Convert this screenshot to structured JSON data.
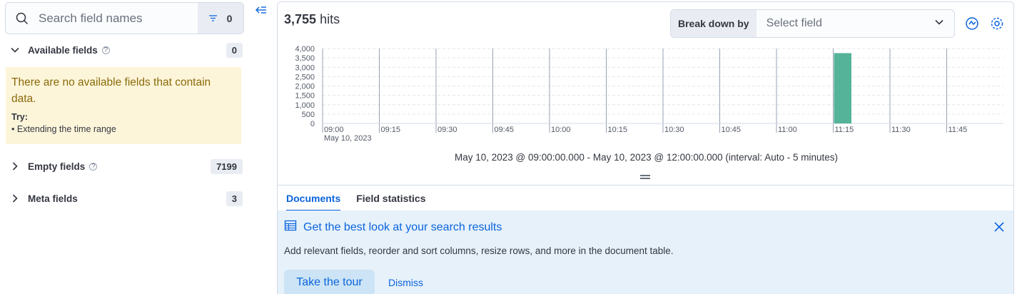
{
  "sidebar": {
    "search_placeholder": "Search field names",
    "filter_count": "0",
    "available": {
      "title": "Available fields",
      "count": "0"
    },
    "callout": {
      "message": "There are no available fields that contain data.",
      "try_label": "Try:",
      "suggestions": [
        "Extending the time range"
      ]
    },
    "empty": {
      "title": "Empty fields",
      "count": "7199"
    },
    "meta": {
      "title": "Meta fields",
      "count": "3"
    }
  },
  "hits": {
    "count": "3,755",
    "label": "hits"
  },
  "breakdown": {
    "label": "Break down by",
    "placeholder": "Select field"
  },
  "chart_data": {
    "type": "bar",
    "x": [
      "09:00",
      "09:05",
      "09:10",
      "09:15",
      "09:20",
      "09:25",
      "09:30",
      "09:35",
      "09:40",
      "09:45",
      "09:50",
      "09:55",
      "10:00",
      "10:05",
      "10:10",
      "10:15",
      "10:20",
      "10:25",
      "10:30",
      "10:35",
      "10:40",
      "10:45",
      "10:50",
      "10:55",
      "11:00",
      "11:05",
      "11:10",
      "11:15",
      "11:20",
      "11:25",
      "11:30",
      "11:35",
      "11:40",
      "11:45",
      "11:50",
      "11:55"
    ],
    "values": [
      0,
      0,
      0,
      0,
      0,
      0,
      0,
      0,
      0,
      0,
      0,
      0,
      0,
      0,
      0,
      0,
      0,
      0,
      0,
      0,
      0,
      0,
      0,
      0,
      0,
      0,
      0,
      3755,
      0,
      0,
      0,
      0,
      0,
      0,
      0,
      0
    ],
    "x_tick_labels": [
      "09:00",
      "09:15",
      "09:30",
      "09:45",
      "10:00",
      "10:15",
      "10:30",
      "10:45",
      "11:00",
      "11:15",
      "11:30",
      "11:45"
    ],
    "x_sublabel": "May 10, 2023",
    "y_tick_labels": [
      "0",
      "500",
      "1,000",
      "1,500",
      "2,000",
      "2,500",
      "3,000",
      "3,500",
      "4,000"
    ],
    "ylim": [
      0,
      4000
    ],
    "bar_color": "#54b399",
    "grid": true
  },
  "interval_text": "May 10, 2023 @ 09:00:00.000 - May 10, 2023 @ 12:00:00.000 (interval: Auto - 5 minutes)",
  "tabs": [
    {
      "label": "Documents",
      "active": true
    },
    {
      "label": "Field statistics",
      "active": false
    }
  ],
  "tour": {
    "title": "Get the best look at your search results",
    "description": "Add relevant fields, reorder and sort columns, resize rows, and more in the document table.",
    "take_tour": "Take the tour",
    "dismiss": "Dismiss"
  }
}
